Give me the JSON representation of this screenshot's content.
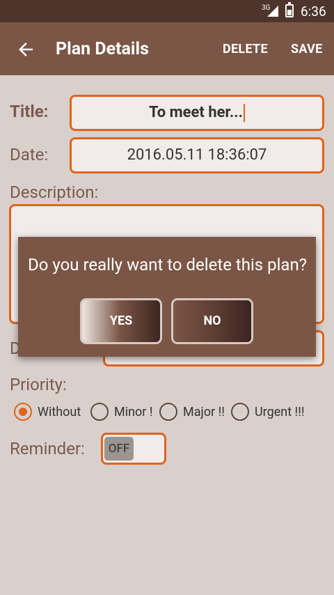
{
  "status_bar": {
    "network": "3G",
    "time": "6:36"
  },
  "app_bar": {
    "title": "Plan Details",
    "delete_label": "DELETE",
    "save_label": "SAVE"
  },
  "form": {
    "title_label": "Title:",
    "title_value": "To meet her...",
    "date_label": "Date:",
    "date_value": "2016.05.11 18:36:07",
    "description_label": "Description:",
    "description_value": "",
    "deadline_label_partial": "D",
    "deadline_value": "",
    "priority_label": "Priority:",
    "priority_options": [
      "Without",
      "Minor !",
      "Major !!",
      "Urgent !!!"
    ],
    "priority_selected": "Without",
    "reminder_label": "Reminder:",
    "reminder_state": "OFF"
  },
  "dialog": {
    "message": "Do you really want to delete this plan?",
    "yes_label": "YES",
    "no_label": "NO"
  },
  "colors": {
    "accent": "#e0641c",
    "app_bar": "#7b5646",
    "status_bar": "#4d352c",
    "background": "#d9d0cc"
  }
}
